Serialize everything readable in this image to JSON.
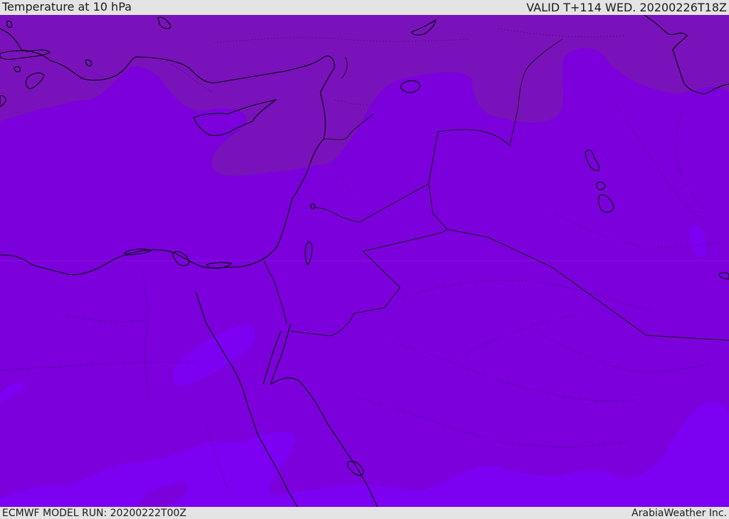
{
  "header": {
    "title": "Temperature at 10 hPa",
    "valid": "VALID T+114 WED. 20200226T18Z"
  },
  "footer": {
    "model_run": "ECMWF MODEL RUN: 20200222T00Z",
    "credit": "ArabiaWeather Inc."
  },
  "map": {
    "field": "Temperature at 10 hPa",
    "colors": {
      "warm_band": "#7a12bb",
      "base_band": "#7b00dc",
      "cool_band": "#7c00f2",
      "coast_line": "#000000",
      "border_line": "#1a1a1a"
    }
  }
}
